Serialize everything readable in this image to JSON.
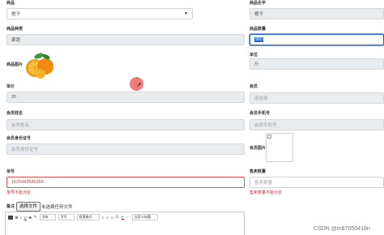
{
  "left": {
    "product_label": "商品",
    "product_value": "橙子",
    "category_label": "商品种类",
    "category_value": "果蔬",
    "image_label": "商品图片",
    "unit_price_label": "单价",
    "unit_price_value": "20",
    "member_name_label": "会员姓名",
    "member_name_placeholder": "会员姓名",
    "member_id_label": "会员身份证号",
    "member_id_placeholder": "会员身份证号",
    "order_no_label": "单号",
    "order_no_value": "1621043585359",
    "order_no_error": "单号不能为空",
    "remark_label": "备注",
    "file_button": "选择文件",
    "file_status": "未选择任何文件"
  },
  "right": {
    "product_name_label": "商品名字",
    "product_name_value": "橙子",
    "stock_label": "商品数量",
    "stock_value": "900",
    "unit_label": "单位",
    "unit_value": "斤",
    "member_label": "会员",
    "member_placeholder": "请选择",
    "member_phone_label": "会员手机号",
    "member_phone_placeholder": "会员手机号",
    "member_image_label": "会员图片",
    "sale_qty_label": "售卖数量",
    "sale_qty_placeholder": "售卖数量",
    "sale_qty_error": "售卖数量不能为空"
  },
  "toolbar": {
    "bold": "B",
    "italic": "I",
    "underline": "U",
    "strike": "S",
    "font_family": "字体",
    "font_size": "字号",
    "paragraph": "段落格式",
    "text_color": "A",
    "custom_title": "自定义标题"
  },
  "watermark": "CSDN @m87050418n",
  "colors": {
    "accent_blue": "#1e66d0",
    "error_red": "#d9232d",
    "field_gray": "#e9ecef"
  }
}
